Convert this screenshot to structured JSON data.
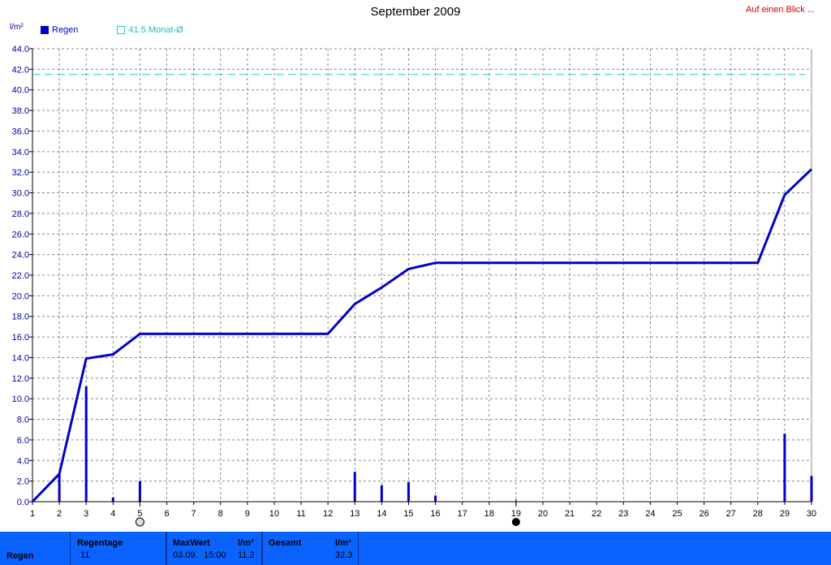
{
  "header": {
    "title": "September 2009",
    "link_label": "Auf einen Blick ...",
    "unit_label": "l/m²"
  },
  "legend": {
    "series_label": "Regen",
    "avg_label": "41.5 Monat-Ø"
  },
  "colors": {
    "series": "#0000cc",
    "avg_line": "#22cccc",
    "grid": "#888888",
    "footer_bg": "#0a63ff"
  },
  "chart_data": {
    "type": "line",
    "title": "September 2009",
    "ylabel": "l/m²",
    "xlabel": "",
    "xlim": [
      1,
      30
    ],
    "ylim": [
      0,
      44
    ],
    "grid": true,
    "legend_position": "top-left",
    "x_ticks": [
      1,
      2,
      3,
      4,
      5,
      6,
      7,
      8,
      9,
      10,
      11,
      12,
      13,
      14,
      15,
      16,
      17,
      18,
      19,
      20,
      21,
      22,
      23,
      24,
      25,
      26,
      27,
      28,
      29,
      30
    ],
    "y_ticks": [
      0,
      2,
      4,
      6,
      8,
      10,
      12,
      14,
      16,
      18,
      20,
      22,
      24,
      26,
      28,
      30,
      32,
      34,
      36,
      38,
      40,
      42,
      44
    ],
    "series": [
      {
        "name": "Regen",
        "kind": "cumulative_line",
        "x": [
          1,
          2,
          3,
          4,
          5,
          6,
          7,
          8,
          9,
          10,
          11,
          12,
          13,
          14,
          15,
          16,
          17,
          18,
          19,
          20,
          21,
          22,
          23,
          24,
          25,
          26,
          27,
          28,
          29,
          30
        ],
        "values": [
          0.0,
          2.7,
          13.9,
          14.3,
          16.3,
          16.3,
          16.3,
          16.3,
          16.3,
          16.3,
          16.3,
          16.3,
          19.2,
          20.8,
          22.6,
          23.2,
          23.2,
          23.2,
          23.2,
          23.2,
          23.2,
          23.2,
          23.2,
          23.2,
          23.2,
          23.2,
          23.2,
          23.2,
          29.8,
          32.3
        ]
      },
      {
        "name": "Regen",
        "kind": "daily_bars",
        "x": [
          2,
          3,
          4,
          5,
          13,
          14,
          15,
          16,
          29,
          30
        ],
        "values": [
          2.7,
          11.2,
          0.4,
          2.0,
          2.9,
          1.6,
          1.9,
          0.6,
          6.6,
          2.5
        ]
      }
    ],
    "reference_line": {
      "label": "41.5 Monat-Ø",
      "value": 41.5
    },
    "moon_markers": [
      {
        "x": 5,
        "phase": "full"
      },
      {
        "x": 19,
        "phase": "new"
      }
    ]
  },
  "footer": {
    "row_label": "Regen",
    "regentage": {
      "header": "Regentage",
      "value": "11"
    },
    "maxwert": {
      "header": "MaxWert",
      "unit": "l/m²",
      "date": "03.09.",
      "time": "15:00",
      "value": "11.2"
    },
    "gesamt": {
      "header": "Gesamt",
      "unit": "l/m²",
      "value": "32.3"
    }
  }
}
